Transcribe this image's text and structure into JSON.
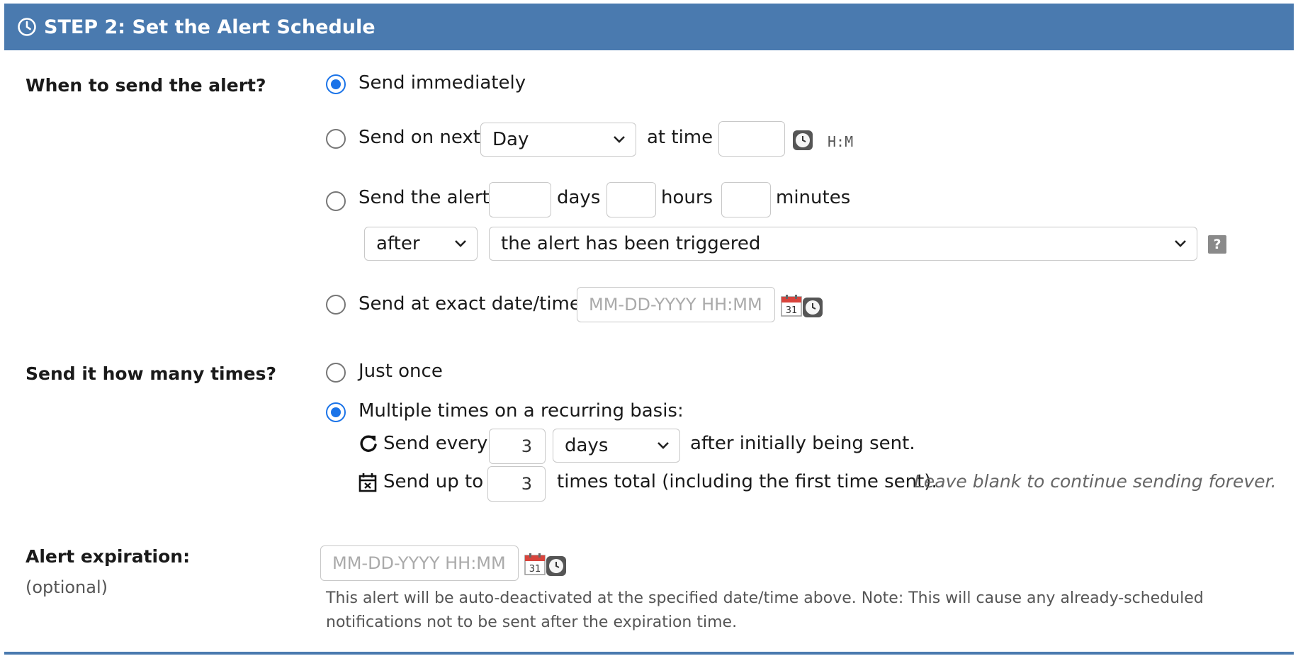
{
  "header": {
    "title": "STEP 2: Set the Alert Schedule"
  },
  "when": {
    "label": "When to send the alert?",
    "immediately": "Send immediately",
    "next_label": "Send on next",
    "next_unit": "Day",
    "at_time": "at time",
    "time_format": "H:M",
    "relative_label": "Send the alert",
    "days": "days",
    "hours": "hours",
    "minutes": "minutes",
    "relation": "after",
    "trigger_event": "the alert has been triggered",
    "help": "?",
    "exact_label": "Send at exact date/time:",
    "datetime_placeholder": "MM-DD-YYYY HH:MM"
  },
  "times": {
    "label": "Send it how many times?",
    "just_once": "Just once",
    "multiple": "Multiple times on a recurring basis:",
    "send_every": "Send every",
    "interval_value": "3",
    "interval_unit": "days",
    "after_initial": "after initially being sent.",
    "send_up_to": "Send up to",
    "max_count": "3",
    "total_text": "times total (including the first time sent).",
    "blank_hint": "Leave blank to continue sending forever."
  },
  "expiration": {
    "label": "Alert expiration:",
    "optional": "(optional)",
    "placeholder": "MM-DD-YYYY HH:MM",
    "note": "This alert will be auto-deactivated at the specified date/time above. Note: This will cause any already-scheduled notifications not to be sent after the expiration time."
  },
  "icons": {
    "clock": "clock-icon",
    "calendar": "calendar-icon",
    "refresh": "refresh-icon",
    "calendar_x": "calendar-x-icon",
    "help": "help-icon",
    "chevron": "chevron-down-icon"
  },
  "colors": {
    "header_bg": "#4a7aaf",
    "radio_checked": "#1a73e8",
    "calendar_red": "#d8443c"
  }
}
